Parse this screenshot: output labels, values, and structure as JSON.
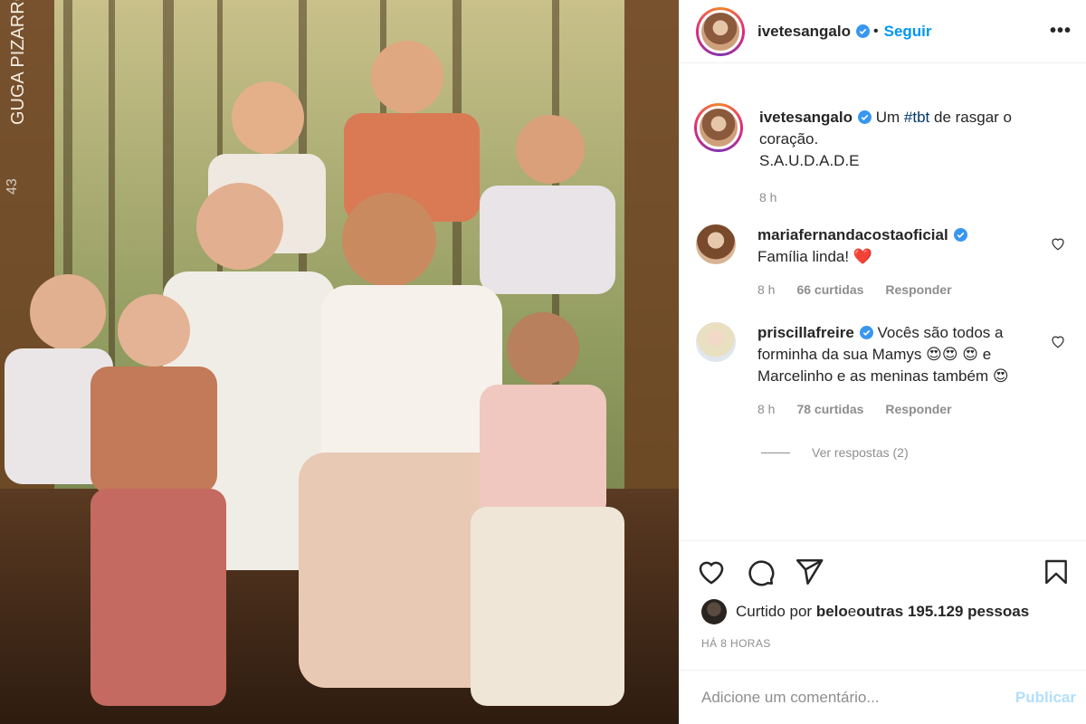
{
  "post": {
    "author": "ivetesangalo",
    "follow_label": "Seguir",
    "separator": "•",
    "more_label": "•••",
    "photo_watermark": "GUGA PIZARRO",
    "caption": {
      "user": "ivetesangalo",
      "text_before": "Um ",
      "hashtag": "#tbt",
      "text_after": " de rasgar o coração.",
      "line2": "S.A.U.D.A.D.E",
      "time": "8 h"
    },
    "comments": [
      {
        "user": "mariafernandacostaoficial",
        "text": "Família linda! ❤️",
        "time": "8 h",
        "likes": "66 curtidas",
        "reply": "Responder"
      },
      {
        "user": "priscillafreire",
        "text": "Vocês são todos a forminha da sua Mamys 😍😍 😍 e Marcelinho e as meninas também 😍",
        "time": "8 h",
        "likes": "78 curtidas",
        "reply": "Responder",
        "view_replies": "Ver respostas (2)"
      }
    ],
    "liked_by": {
      "prefix": "Curtido por ",
      "user": "belo",
      "middle": " e ",
      "others": "outras 195.129 pessoas"
    },
    "timestamp": "HÁ 8 HORAS",
    "comment_placeholder": "Adicione um comentário...",
    "publish_label": "Publicar"
  },
  "colors": {
    "link": "#0095f6",
    "hashtag": "#00376b",
    "muted": "#8e8e8e",
    "publish_disabled": "#b2dffc"
  }
}
